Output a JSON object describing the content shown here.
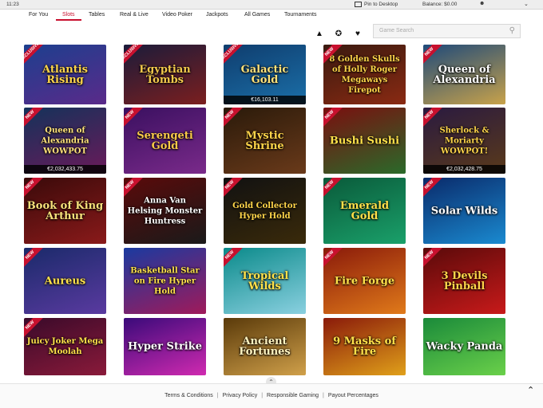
{
  "system_bar": {
    "time": "11:23",
    "pin_label": "Pin to Desktop",
    "balance_label": "Balance: $0.00"
  },
  "nav": {
    "tabs": [
      "For You",
      "Slots",
      "Tables",
      "Real & Live",
      "Video Poker",
      "Jackpots",
      "All Games",
      "Tournaments"
    ],
    "active_tab": "Slots"
  },
  "toolbar": {
    "search_placeholder": "Game Search",
    "icons": [
      "fire-icon",
      "puzzle-icon",
      "heart-icon",
      "search-icon"
    ]
  },
  "games": [
    {
      "title": "Atlantis Rising",
      "badge": "EXCLUSIVE",
      "jackpot": "",
      "colors": [
        "#1d3f8e",
        "#5a2a8a"
      ],
      "text_color": "#ffd54a"
    },
    {
      "title": "Egyptian Tombs",
      "badge": "EXCLUSIVE",
      "jackpot": "",
      "colors": [
        "#1b1b3a",
        "#7b1f1f"
      ],
      "text_color": "#f2c94c"
    },
    {
      "title": "Galactic Gold",
      "badge": "EXCLUSIVE",
      "jackpot": "€16,103.11",
      "colors": [
        "#0f3d6e",
        "#1b6fa8"
      ],
      "text_color": "#ffe27a"
    },
    {
      "title": "8 Golden Skulls of Holly Roger Megaways Firepot",
      "badge": "NEW",
      "jackpot": "",
      "colors": [
        "#3a1a10",
        "#8a2a12"
      ],
      "text_color": "#ffd54a"
    },
    {
      "title": "Queen of Alexandria",
      "badge": "NEW",
      "jackpot": "",
      "colors": [
        "#1f4a7a",
        "#c8a24a"
      ],
      "text_color": "#ffffff"
    },
    {
      "title": "Queen of Alexandria WOWPOT",
      "badge": "NEW",
      "jackpot": "€2,032,433.75",
      "colors": [
        "#14325a",
        "#6a1a5a"
      ],
      "text_color": "#ffe27a"
    },
    {
      "title": "Serengeti Gold",
      "badge": "NEW",
      "jackpot": "",
      "colors": [
        "#3a1060",
        "#7a2a8a"
      ],
      "text_color": "#f7c948"
    },
    {
      "title": "Mystic Shrine",
      "badge": "NEW",
      "jackpot": "",
      "colors": [
        "#2a1a0a",
        "#6a3a1a"
      ],
      "text_color": "#ffd54a"
    },
    {
      "title": "Bushi Sushi",
      "badge": "NEW",
      "jackpot": "",
      "colors": [
        "#7a0f0f",
        "#2a6a2a"
      ],
      "text_color": "#ffe14a"
    },
    {
      "title": "Sherlock & Moriarty WOWPOT!",
      "badge": "NEW",
      "jackpot": "€2,032,428.75",
      "colors": [
        "#2a1a40",
        "#5a3a1a"
      ],
      "text_color": "#ffd54a"
    },
    {
      "title": "Book of King Arthur",
      "badge": "NEW",
      "jackpot": "",
      "colors": [
        "#3a0a0a",
        "#8a1a1a"
      ],
      "text_color": "#f7e07a"
    },
    {
      "title": "Anna Van Helsing Monster Huntress",
      "badge": "NEW",
      "jackpot": "",
      "colors": [
        "#5a0a0a",
        "#1a1a1a"
      ],
      "text_color": "#ffffff"
    },
    {
      "title": "Gold Collector Hyper Hold",
      "badge": "NEW",
      "jackpot": "",
      "colors": [
        "#111111",
        "#3a2a0a"
      ],
      "text_color": "#ffd54a"
    },
    {
      "title": "Emerald Gold",
      "badge": "NEW",
      "jackpot": "",
      "colors": [
        "#0a5a3a",
        "#1aa06a"
      ],
      "text_color": "#ffe14a"
    },
    {
      "title": "Solar Wilds",
      "badge": "NEW",
      "jackpot": "",
      "colors": [
        "#0a2a6a",
        "#1a8ad0"
      ],
      "text_color": "#ffffff"
    },
    {
      "title": "Aureus",
      "badge": "NEW",
      "jackpot": "",
      "colors": [
        "#1a2a6a",
        "#5a3aa0"
      ],
      "text_color": "#ffe14a"
    },
    {
      "title": "Basketball Star on Fire Hyper Hold",
      "badge": "",
      "jackpot": "",
      "colors": [
        "#1a3aa0",
        "#a01a5a"
      ],
      "text_color": "#ffe14a"
    },
    {
      "title": "Tropical Wilds",
      "badge": "NEW",
      "jackpot": "",
      "colors": [
        "#0a8a8a",
        "#8ad0e0"
      ],
      "text_color": "#ffe14a"
    },
    {
      "title": "Fire Forge",
      "badge": "NEW",
      "jackpot": "",
      "colors": [
        "#8a1a0a",
        "#e07a1a"
      ],
      "text_color": "#ffe14a"
    },
    {
      "title": "3 Devils Pinball",
      "badge": "NEW",
      "jackpot": "",
      "colors": [
        "#5a0a0a",
        "#c81a1a"
      ],
      "text_color": "#ffd54a"
    },
    {
      "title": "Juicy Joker Mega Moolah",
      "badge": "NEW",
      "jackpot": "",
      "colors": [
        "#3a0a2a",
        "#8a1a3a"
      ],
      "text_color": "#ffe14a"
    },
    {
      "title": "Hyper Strike",
      "badge": "",
      "jackpot": "",
      "colors": [
        "#3a0a7a",
        "#d02ab0"
      ],
      "text_color": "#ffffff"
    },
    {
      "title": "Ancient Fortunes",
      "badge": "",
      "jackpot": "",
      "colors": [
        "#5a3a0a",
        "#d0a04a"
      ],
      "text_color": "#fff3c0"
    },
    {
      "title": "9 Masks of Fire",
      "badge": "",
      "jackpot": "",
      "colors": [
        "#8a1a0a",
        "#e0a01a"
      ],
      "text_color": "#ffe14a"
    },
    {
      "title": "Wacky Panda",
      "badge": "",
      "jackpot": "",
      "colors": [
        "#1a8a3a",
        "#6ad04a"
      ],
      "text_color": "#ffffff"
    }
  ],
  "footer": {
    "links": [
      "Terms & Conditions",
      "Privacy Policy",
      "Responsible Gaming",
      "Payout Percentages"
    ]
  }
}
